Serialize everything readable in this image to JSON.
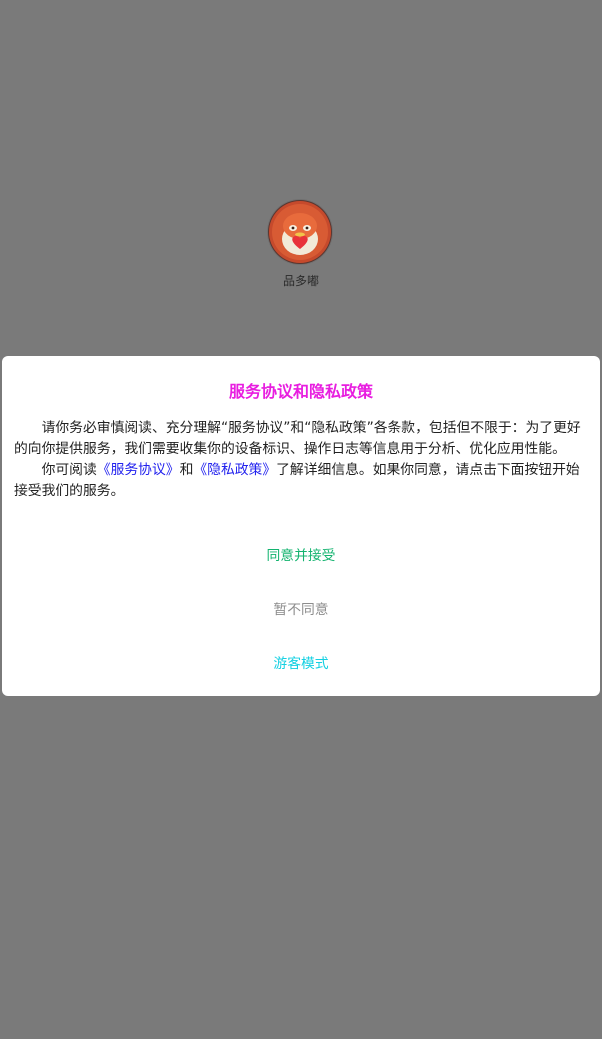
{
  "splash": {
    "app_name": "品多嘟"
  },
  "dialog": {
    "title": "服务协议和隐私政策",
    "p1": "请你务必审慎阅读、充分理解“服务协议”和“隐私政策”各条款，包括但不限于：为了更好的向你提供服务，我们需要收集你的设备标识、操作日志等信息用于分析、优化应用性能。",
    "p2_prefix": "你可阅读",
    "service_link": "《服务协议》",
    "and_text": "和",
    "privacy_link": "《隐私政策》",
    "p2_suffix": "了解详细信息。如果你同意，请点击下面按钮开始接受我们的服务。",
    "agree_label": "同意并接受",
    "disagree_label": "暂不同意",
    "guest_label": "游客模式"
  },
  "colors": {
    "title": "#e81ee0",
    "agree": "#13b36f",
    "disagree": "#8d8d8d",
    "guest": "#13d0e2",
    "link": "#2222ee"
  }
}
